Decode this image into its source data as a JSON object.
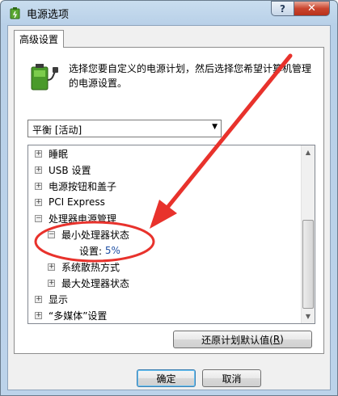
{
  "window": {
    "title": "电源选项",
    "help_label": "?",
    "close_label": "✕"
  },
  "tab": {
    "label": "高级设置"
  },
  "description": {
    "line1": "选择您要自定义的电源计划，然后选择您希望计算机管理",
    "line2": "的电源设置。"
  },
  "plan_select": {
    "value": "平衡 [活动]",
    "arrow": "▼"
  },
  "tree": {
    "expand_symbol": "+",
    "collapse_symbol": "−",
    "items": [
      {
        "label": "睡眠"
      },
      {
        "label": "USB 设置"
      },
      {
        "label": "电源按钮和盖子"
      },
      {
        "label": "PCI Express"
      },
      {
        "label": "处理器电源管理"
      },
      {
        "label": "最小处理器状态"
      },
      {
        "label": "设置:",
        "value": "5%"
      },
      {
        "label": "系统散热方式"
      },
      {
        "label": "最大处理器状态"
      },
      {
        "label": "显示"
      },
      {
        "label": "“多媒体”设置"
      }
    ]
  },
  "scrollbar": {
    "up": "▲",
    "down": "▼"
  },
  "buttons": {
    "restore": {
      "label": "还原计划默认值(",
      "key": "R",
      "suffix": ")"
    },
    "ok": "确定",
    "cancel": "取消"
  },
  "annotation_color": "#e8322c"
}
